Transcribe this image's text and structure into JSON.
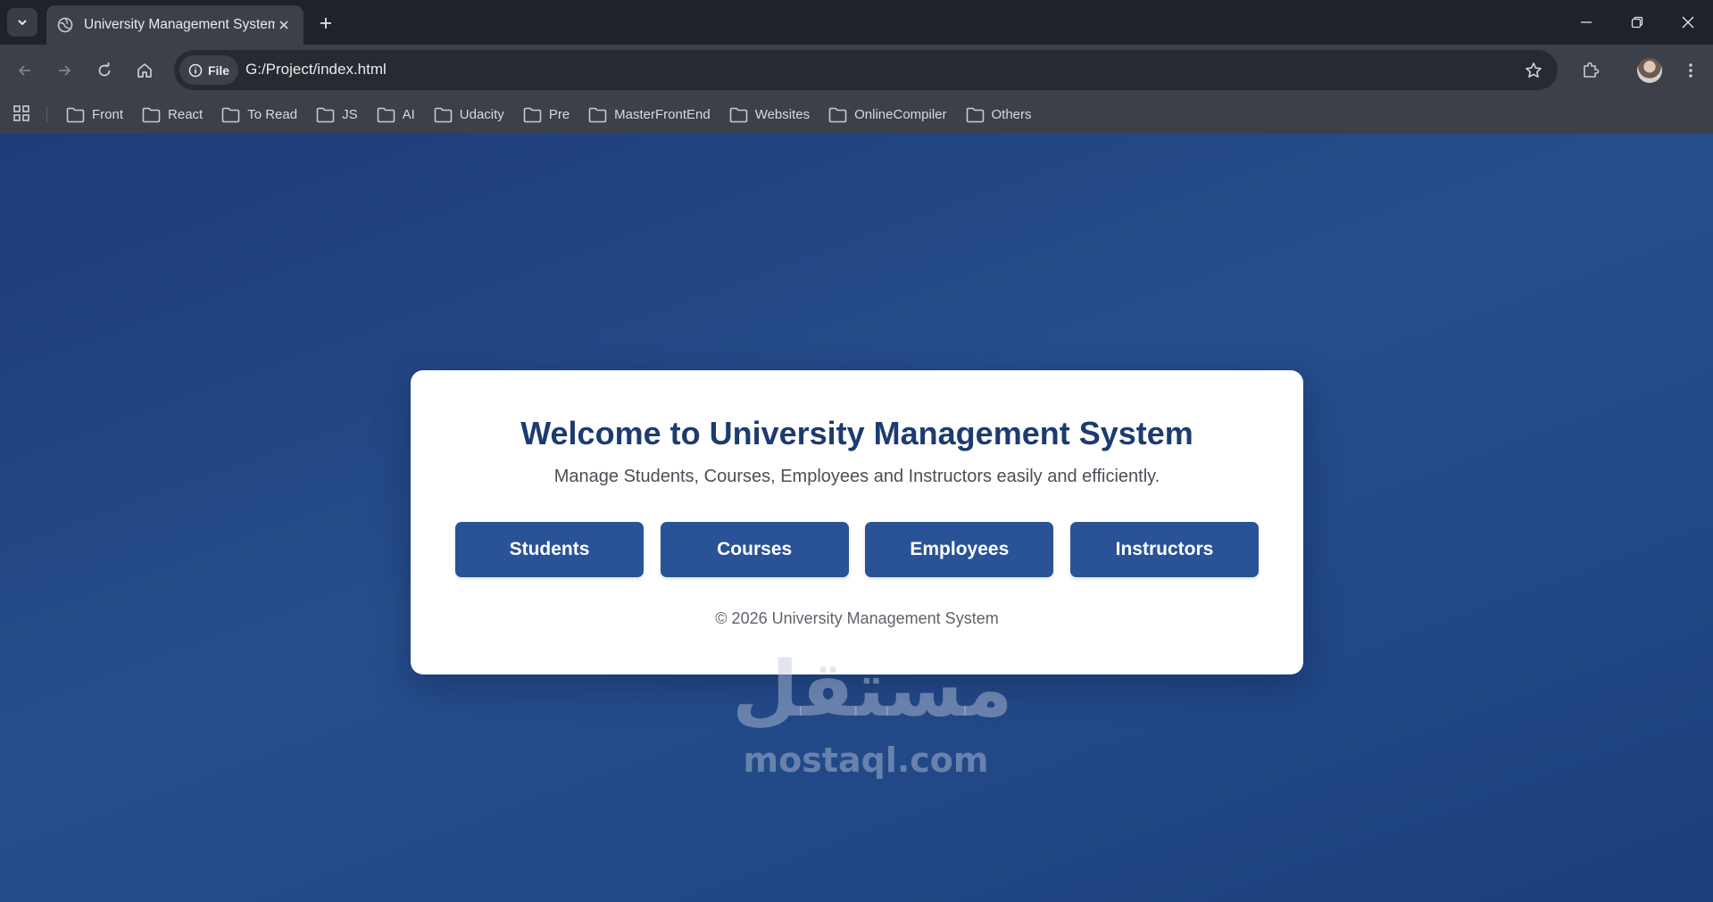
{
  "browser": {
    "tab": {
      "title": "University Management System",
      "favicon": "globe-icon"
    },
    "address_bar": {
      "chip_label": "File",
      "url": "G:/Project/index.html"
    },
    "bookmarks": [
      {
        "label": "Front"
      },
      {
        "label": "React"
      },
      {
        "label": "To Read"
      },
      {
        "label": "JS"
      },
      {
        "label": "AI"
      },
      {
        "label": "Udacity"
      },
      {
        "label": "Pre"
      },
      {
        "label": "MasterFrontEnd"
      },
      {
        "label": "Websites"
      },
      {
        "label": "OnlineCompiler"
      },
      {
        "label": "Others"
      }
    ]
  },
  "page": {
    "title": "Welcome to University Management System",
    "subtitle": "Manage Students, Courses, Employees and Instructors easily and efficiently.",
    "buttons": [
      {
        "label": "Students"
      },
      {
        "label": "Courses"
      },
      {
        "label": "Employees"
      },
      {
        "label": "Instructors"
      }
    ],
    "footer": "© 2026 University Management System"
  },
  "watermark": {
    "arabic": "مستقل",
    "latin": "mostaql.com"
  },
  "colors": {
    "page_background": "#244a88",
    "card_title": "#1d3b70",
    "button_bg": "#295396",
    "chrome_dark": "#1f2229",
    "chrome_toolbar": "#3c4048"
  }
}
